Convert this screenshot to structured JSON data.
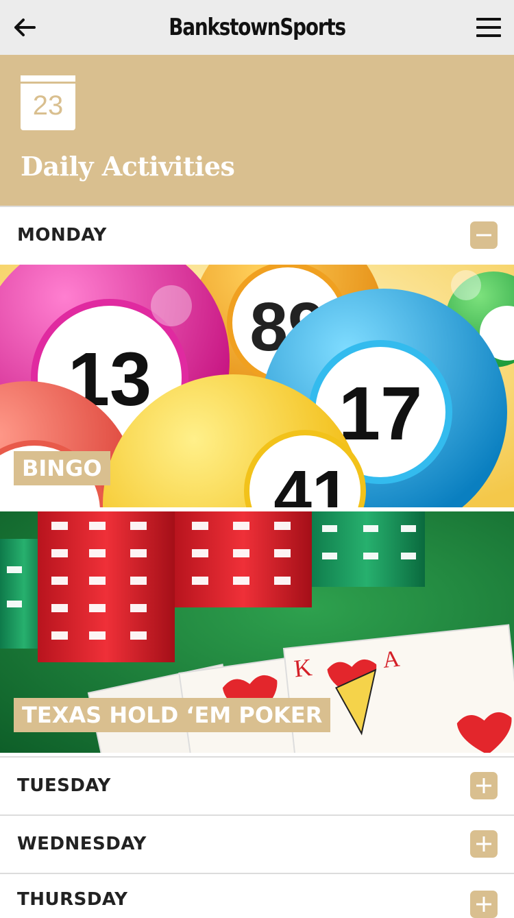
{
  "topbar": {
    "brand": "BankstownSports",
    "back_icon": "arrow-left-icon",
    "menu_icon": "hamburger-menu-icon"
  },
  "header": {
    "calendar_day": "23",
    "title": "Daily Activities",
    "background_color": "#d9bf8f"
  },
  "days": [
    {
      "label": "MONDAY",
      "expanded": true,
      "toggle_icon": "minus-icon"
    },
    {
      "label": "TUESDAY",
      "expanded": false,
      "toggle_icon": "plus-icon"
    },
    {
      "label": "WEDNESDAY",
      "expanded": false,
      "toggle_icon": "plus-icon"
    },
    {
      "label": "THURSDAY",
      "expanded": false,
      "toggle_icon": "plus-icon"
    }
  ],
  "activities": [
    {
      "label": "BINGO",
      "ball_numbers": [
        "13",
        "89",
        "17",
        "41"
      ]
    },
    {
      "label": "TEXAS HOLD ‘EM POKER",
      "card_letters": [
        "K",
        "A"
      ]
    }
  ]
}
